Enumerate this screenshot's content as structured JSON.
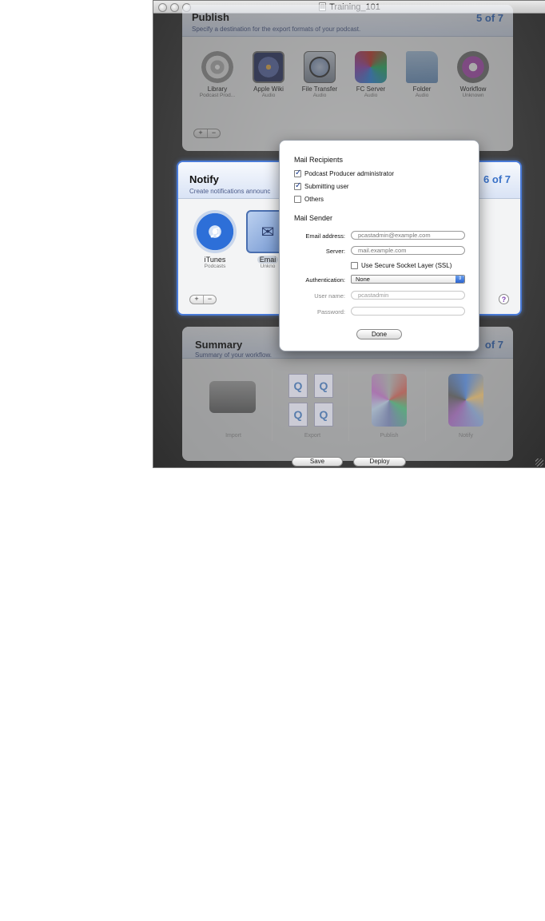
{
  "window": {
    "title": "Training_101"
  },
  "publish": {
    "title": "Publish",
    "subtitle": "Specify a destination for the export formats of your podcast.",
    "count": "5 of 7",
    "items": [
      {
        "name": "Library",
        "sub": "Podcast Prod...",
        "icon": "library-icon"
      },
      {
        "name": "Apple Wiki",
        "sub": "Audio",
        "icon": "wiki-icon"
      },
      {
        "name": "File Transfer",
        "sub": "Audio",
        "icon": "file-transfer-icon"
      },
      {
        "name": "FC Server",
        "sub": "Audio",
        "icon": "fc-server-icon"
      },
      {
        "name": "Folder",
        "sub": "Audio",
        "icon": "folder-icon"
      },
      {
        "name": "Workflow",
        "sub": "Unknown",
        "icon": "workflow-icon"
      }
    ],
    "plus": "+",
    "minus": "−"
  },
  "notify": {
    "title": "Notify",
    "subtitle": "Create notifications announc",
    "count": "6 of 7",
    "items": [
      {
        "name": "iTunes",
        "sub": "Podcasts",
        "icon": "itunes-icon"
      },
      {
        "name": "Emai",
        "sub": "Unkno",
        "icon": "mail-icon"
      }
    ],
    "plus": "+",
    "minus": "−",
    "help": "?"
  },
  "summary": {
    "title": "Summary",
    "subtitle": "Summary of your workflow.",
    "count": "of 7",
    "cells": [
      "Import",
      "Export",
      "Publish",
      "Notify"
    ]
  },
  "buttons": {
    "save": "Save",
    "deploy": "Deploy"
  },
  "popover": {
    "recipients_heading": "Mail Recipients",
    "recipients": [
      {
        "label": "Podcast Producer administrator",
        "checked": true
      },
      {
        "label": "Submitting user",
        "checked": true
      },
      {
        "label": "Others",
        "checked": false
      }
    ],
    "sender_heading": "Mail Sender",
    "email_label": "Email address:",
    "email_value": "pcastadmin@example.com",
    "server_label": "Server:",
    "server_value": "mail.example.com",
    "ssl_label": "Use Secure Socket Layer (SSL)",
    "auth_label": "Authentication:",
    "auth_value": "None",
    "username_label": "User name:",
    "username_value": "pcastadmin",
    "password_label": "Password:",
    "password_value": "",
    "done": "Done"
  }
}
